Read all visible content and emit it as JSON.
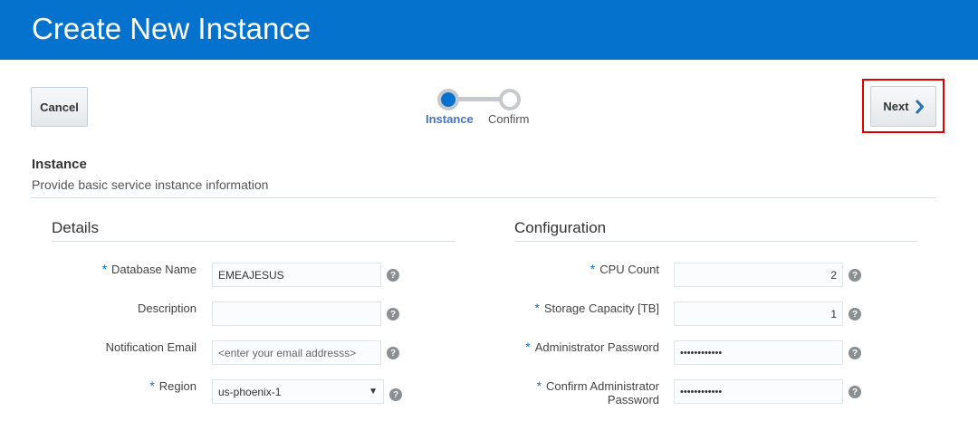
{
  "header": {
    "title": "Create New Instance"
  },
  "toolbar": {
    "cancel_label": "Cancel",
    "next_label": "Next"
  },
  "train": {
    "steps": [
      {
        "label": "Instance",
        "state": "current"
      },
      {
        "label": "Confirm",
        "state": "upcoming"
      }
    ]
  },
  "section": {
    "title": "Instance",
    "subtitle": "Provide basic service instance information"
  },
  "details": {
    "title": "Details",
    "fields": {
      "database_name": {
        "label": "Database Name",
        "required": "*",
        "value": "EMEAJESUS"
      },
      "description": {
        "label": "Description",
        "value": ""
      },
      "notification_email": {
        "label": "Notification Email",
        "placeholder": "<enter your email addresss>"
      },
      "region": {
        "label": "Region",
        "required": "*",
        "value": "us-phoenix-1"
      }
    }
  },
  "configuration": {
    "title": "Configuration",
    "fields": {
      "cpu_count": {
        "label": "CPU Count",
        "required": "*",
        "value": "2"
      },
      "storage_capacity": {
        "label": "Storage Capacity [TB]",
        "required": "*",
        "value": "1"
      },
      "admin_password": {
        "label": "Administrator Password",
        "required": "*",
        "value": "••••••••••••"
      },
      "confirm_admin_password": {
        "label_line1": "Confirm Administrator",
        "label_line2": "Password",
        "required": "*",
        "value": "••••••••••••"
      }
    }
  },
  "help_glyph": "?",
  "colors": {
    "header": "#0572ce",
    "highlight": "#e00000",
    "required": "#0572ce",
    "active_step": "#4574c5"
  },
  "icons": {
    "next": "chevron-right-icon",
    "help": "question-circle-icon",
    "dropdown": "caret-down-icon"
  }
}
